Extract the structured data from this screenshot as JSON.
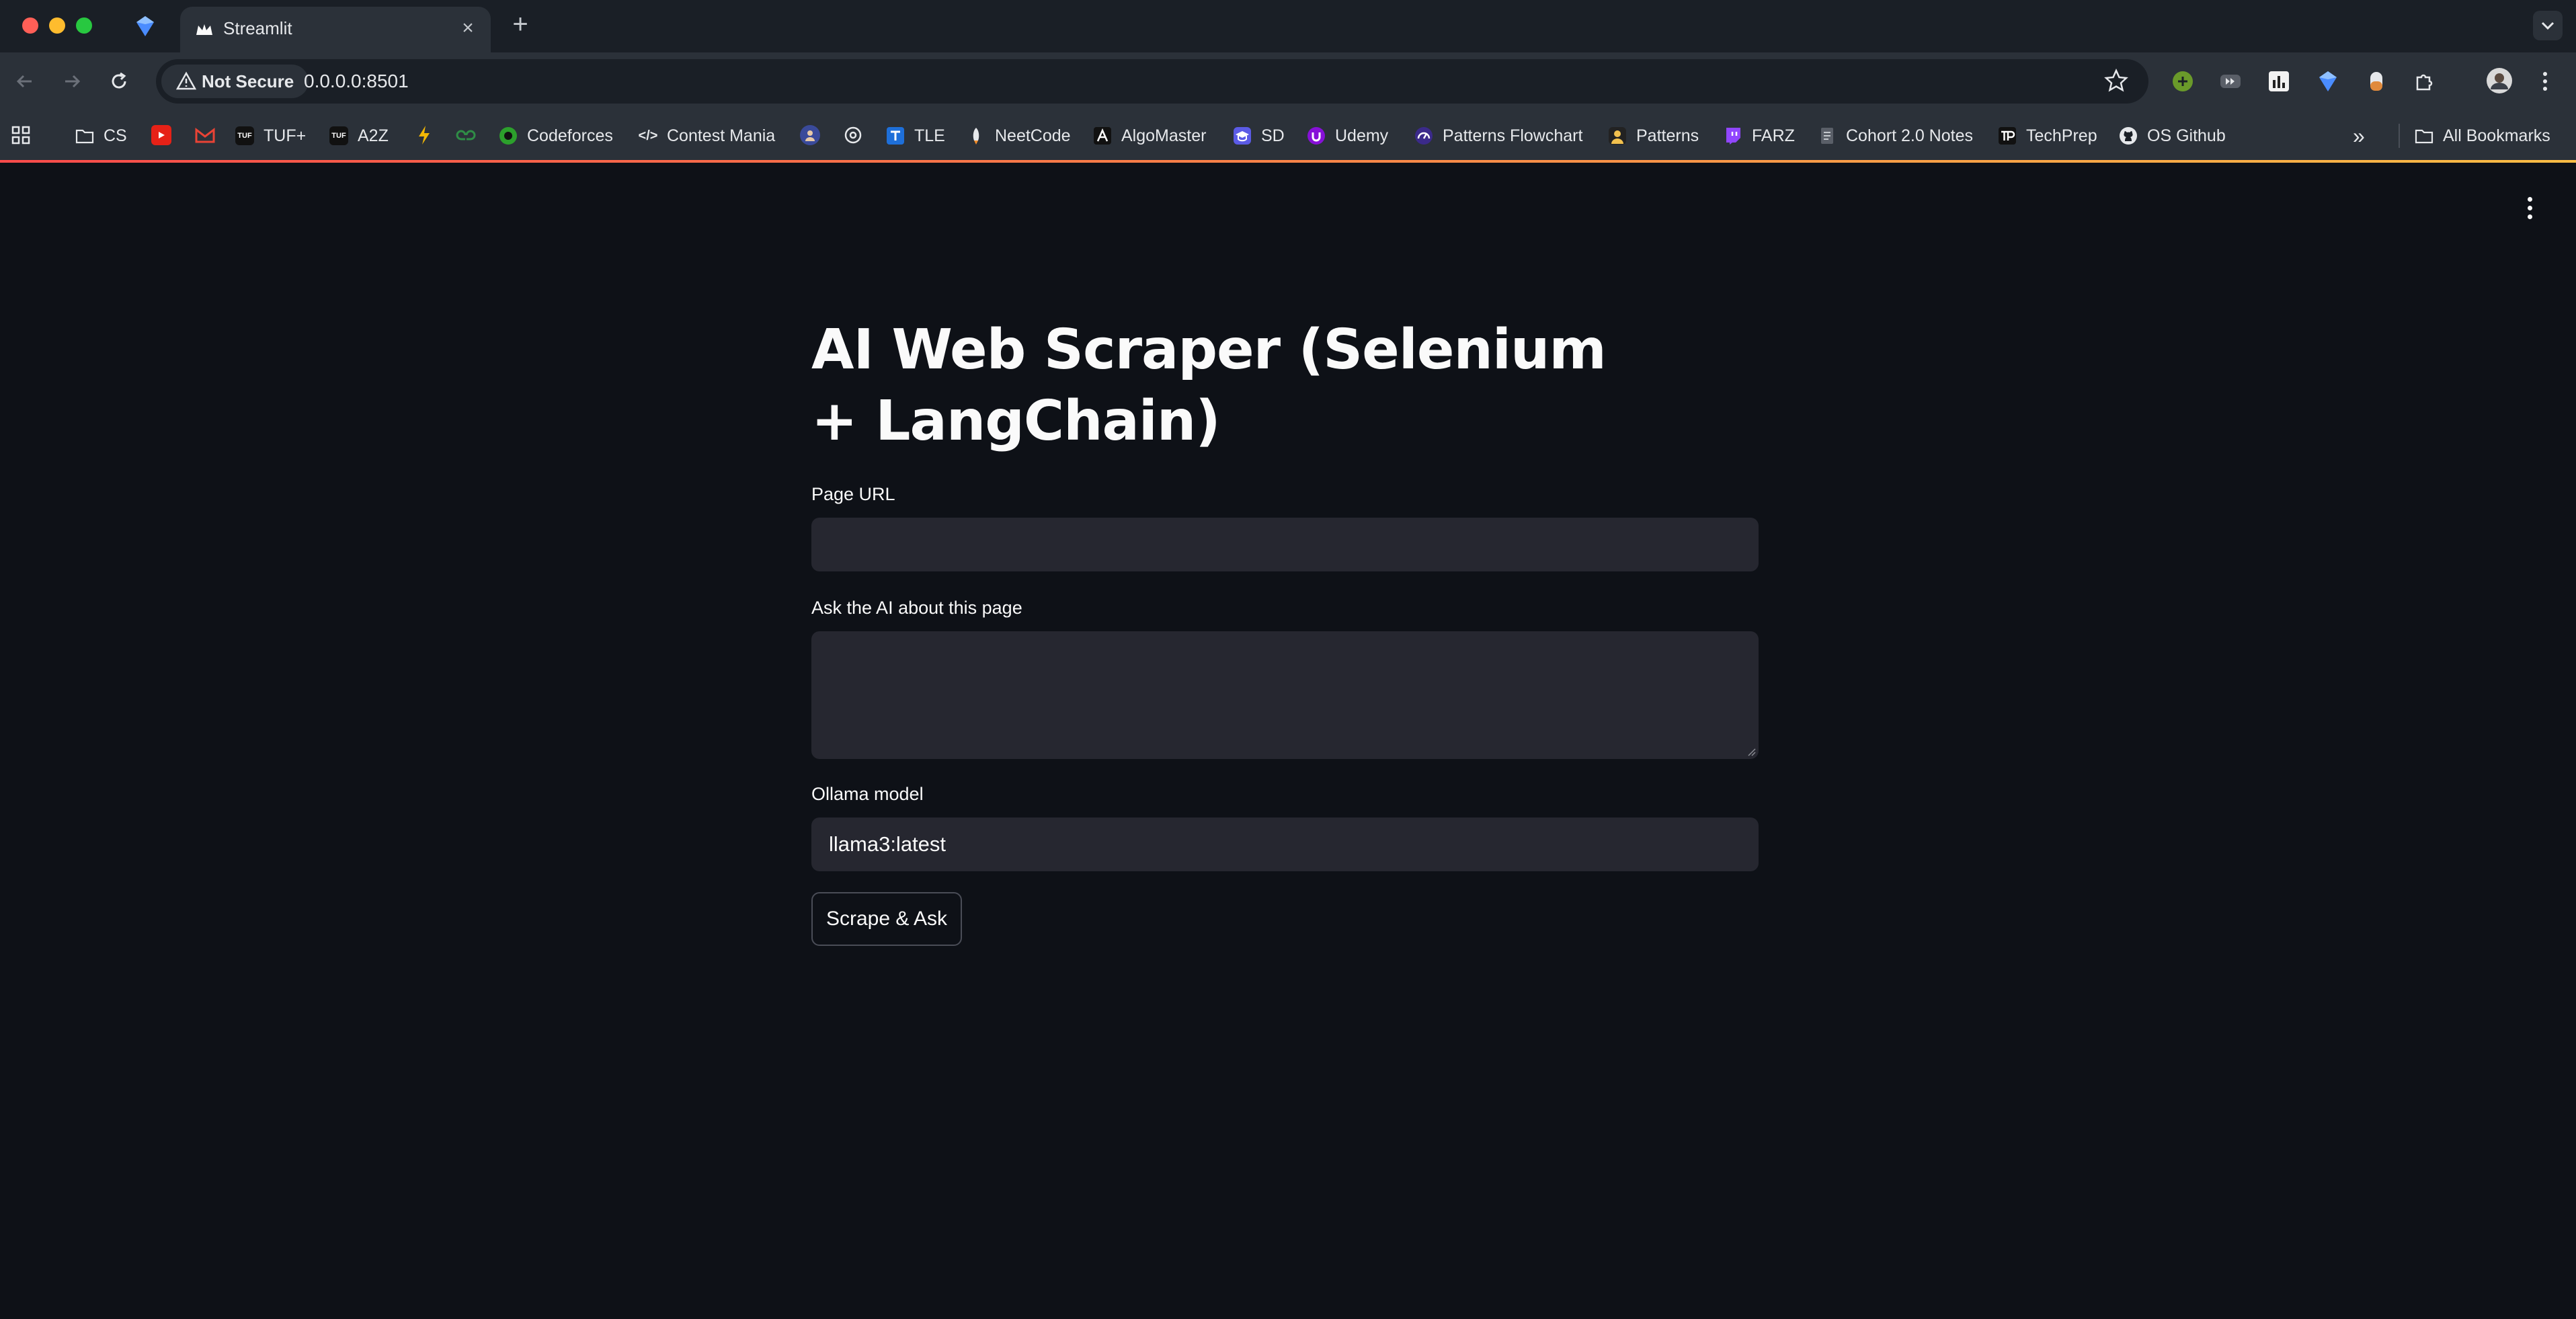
{
  "window": {
    "active_tab_title": "Streamlit",
    "new_tab_label": "+",
    "close_label": "×"
  },
  "toolbar": {
    "security_label": "Not Secure",
    "url": "0.0.0.0:8501"
  },
  "bookmarks": {
    "items": [
      {
        "label": "CS"
      },
      {
        "label": "TUF+"
      },
      {
        "label": "A2Z"
      },
      {
        "label": "Codeforces"
      },
      {
        "label": "Contest Mania"
      },
      {
        "label": "TLE"
      },
      {
        "label": "NeetCode"
      },
      {
        "label": "AlgoMaster"
      },
      {
        "label": "SD"
      },
      {
        "label": "Udemy"
      },
      {
        "label": "Patterns Flowchart"
      },
      {
        "label": "Patterns"
      },
      {
        "label": "FARZ"
      },
      {
        "label": "Cohort 2.0 Notes"
      },
      {
        "label": "TechPrep"
      },
      {
        "label": "OS Github"
      }
    ],
    "overflow_label": "»",
    "all_bookmarks_label": "All Bookmarks"
  },
  "app": {
    "title": "AI Web Scraper (Selenium + LangChain)",
    "page_url_label": "Page URL",
    "page_url_value": "",
    "ask_label": "Ask the AI about this page",
    "ask_value": "",
    "model_label": "Ollama model",
    "model_value": "llama3:latest",
    "submit_label": "Scrape & Ask"
  },
  "colors": {
    "background": "#0e1117",
    "input_bg": "#262730",
    "text": "#fafafa",
    "accent_gradient_start": "#ff4b4b",
    "accent_gradient_end": "#ffbd45"
  }
}
